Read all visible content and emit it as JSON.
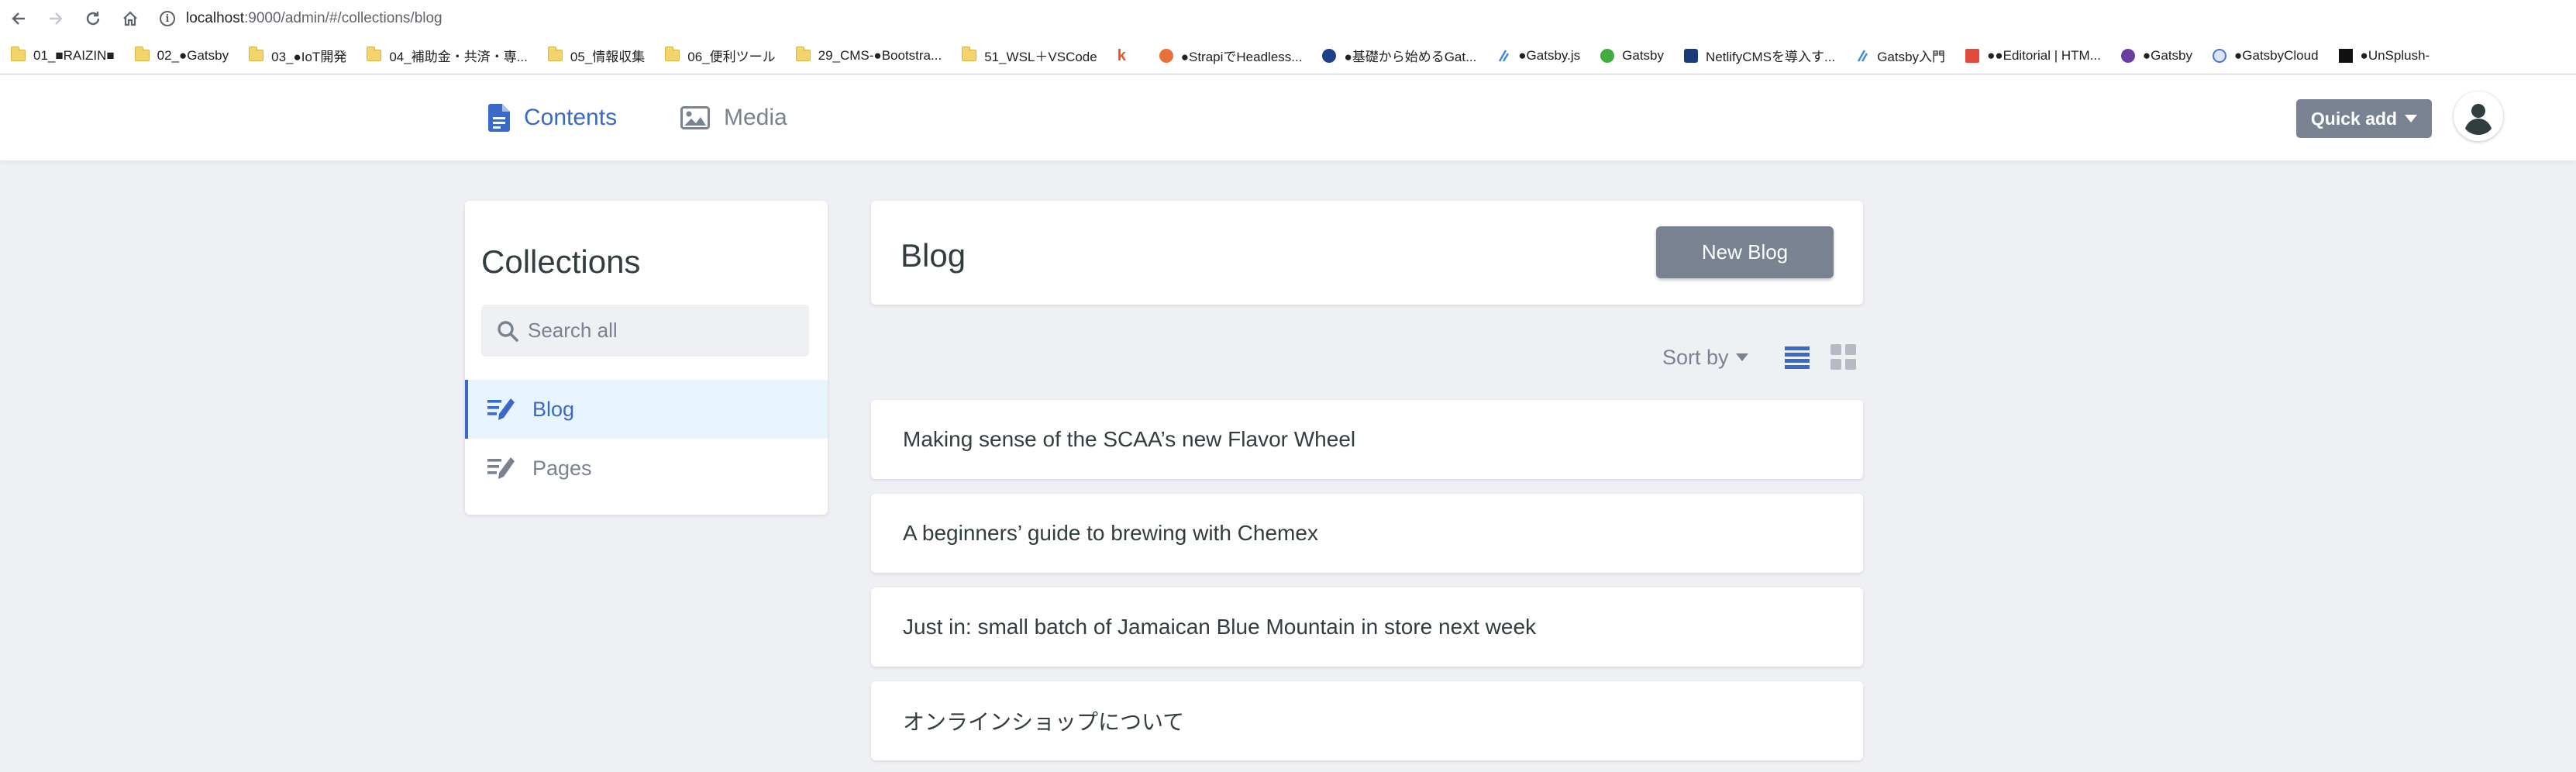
{
  "browser": {
    "url_host": "localhost",
    "url_rest": ":9000/admin/#/collections/blog",
    "bookmarks": [
      {
        "label": "01_■RAIZIN■",
        "icon": "folder-icon"
      },
      {
        "label": "02_●Gatsby",
        "icon": "folder-icon"
      },
      {
        "label": "03_●IoT開発",
        "icon": "folder-icon"
      },
      {
        "label": "04_補助金・共済・専...",
        "icon": "folder-icon"
      },
      {
        "label": "05_情報収集",
        "icon": "folder-icon"
      },
      {
        "label": "06_便利ツール",
        "icon": "folder-icon"
      },
      {
        "label": "29_CMS-●Bootstra...",
        "icon": "folder-icon"
      },
      {
        "label": "51_WSL＋VSCode",
        "icon": "folder-icon"
      },
      {
        "label": "",
        "icon": "k-logo-icon"
      },
      {
        "label": "●StrapiでHeadless...",
        "icon": "strapi-icon"
      },
      {
        "label": "●基礎から始めるGat...",
        "icon": "site-icon"
      },
      {
        "label": "●Gatsby.js",
        "icon": "slash-logo-icon"
      },
      {
        "label": "Gatsby",
        "icon": "gatsby-icon"
      },
      {
        "label": "NetlifyCMSを導入す...",
        "icon": "netlify-icon"
      },
      {
        "label": "Gatsby入門",
        "icon": "slash-logo-icon"
      },
      {
        "label": "●●Editorial | HTM...",
        "icon": "html5up-icon"
      },
      {
        "label": "●Gatsby",
        "icon": "github-icon"
      },
      {
        "label": "●GatsbyCloud",
        "icon": "cloud-icon"
      },
      {
        "label": "●UnSplush-",
        "icon": "unsplash-icon"
      }
    ]
  },
  "header": {
    "contents_label": "Contents",
    "media_label": "Media",
    "quick_add_label": "Quick add"
  },
  "sidebar": {
    "title": "Collections",
    "search_placeholder": "Search all",
    "items": [
      {
        "label": "Blog",
        "active": true
      },
      {
        "label": "Pages",
        "active": false
      }
    ]
  },
  "main": {
    "title": "Blog",
    "new_button_label": "New Blog",
    "sort_label": "Sort by",
    "entries": [
      "Making sense of the SCAA’s new Flavor Wheel",
      "A beginners’ guide to brewing with Chemex",
      "Just in: small batch of Jamaican Blue Mountain in store next week",
      "オンラインショップについて"
    ]
  },
  "colors": {
    "accent": "#3a69c7",
    "muted": "#798291",
    "background": "#eff0f4",
    "active_item_bg": "#e8f5fe"
  }
}
